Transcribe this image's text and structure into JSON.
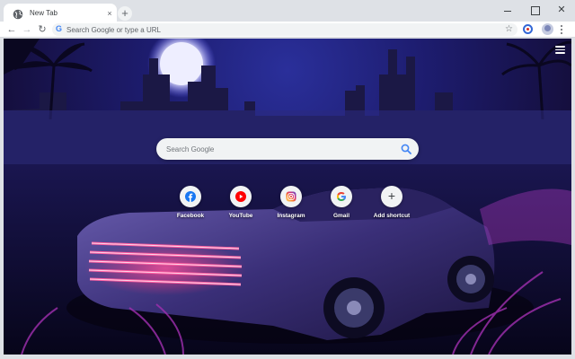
{
  "browser": {
    "tab": {
      "title": "New Tab",
      "close_glyph": "×",
      "favicon": "globe-icon"
    },
    "new_tab_glyph": "+",
    "window_controls": {
      "minimize": "",
      "maximize": "",
      "close": "✕"
    }
  },
  "toolbar": {
    "back_glyph": "←",
    "forward_glyph": "→",
    "reload_glyph": "↻",
    "omnibox": {
      "placeholder": "Search Google or type a URL",
      "value": "",
      "prefix": "G"
    },
    "bookmark_glyph": "☆",
    "extension_icon": "extension-icon",
    "profile_icon": "avatar-icon",
    "menu_icon": "kebab-menu-icon"
  },
  "ntp": {
    "menu_icon": "hamburger-icon",
    "search": {
      "placeholder": "Search Google",
      "value": ""
    },
    "shortcuts": [
      {
        "label": "Facebook",
        "icon": "facebook-icon",
        "color": "#1877f2"
      },
      {
        "label": "YouTube",
        "icon": "youtube-icon",
        "color": "#ff0000"
      },
      {
        "label": "Instagram",
        "icon": "instagram-icon",
        "color": "#c13584"
      },
      {
        "label": "Gmail",
        "icon": "google-icon",
        "color": "#4285f4"
      },
      {
        "label": "Add shortcut",
        "icon": "plus-icon",
        "glyph": "+"
      }
    ],
    "background": {
      "theme": "synthwave city with neon car",
      "sky_color": "#1d1c6e",
      "neon_color": "#ff2f7a",
      "moon_color": "#e8e8ff"
    }
  }
}
